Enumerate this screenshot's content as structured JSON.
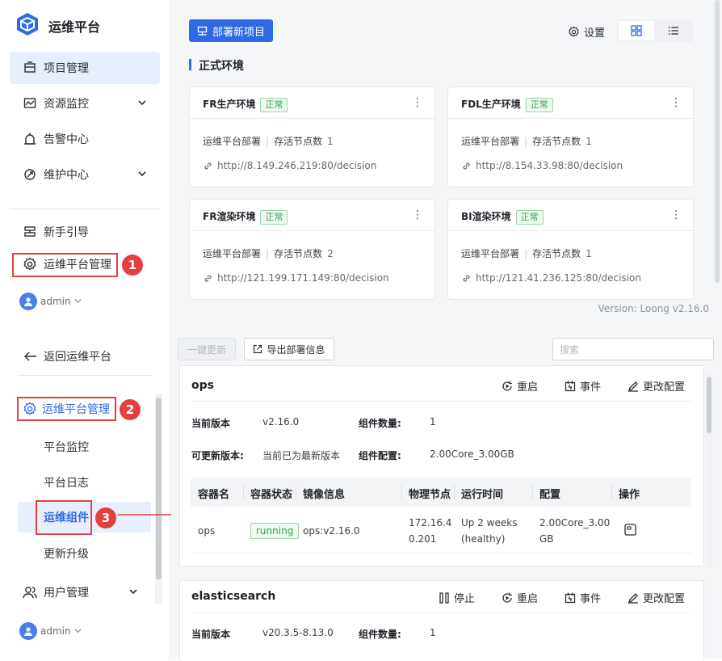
{
  "top": {
    "brand": "运维平台",
    "nav": [
      {
        "label": "项目管理",
        "icon": "project-icon",
        "active": true
      },
      {
        "label": "资源监控",
        "icon": "monitor-icon",
        "expandable": true
      },
      {
        "label": "告警中心",
        "icon": "alarm-icon"
      },
      {
        "label": "维护中心",
        "icon": "maintenance-icon",
        "expandable": true
      }
    ],
    "bottom_nav": [
      {
        "label": "新手引导",
        "icon": "guide-icon"
      },
      {
        "label": "运维平台管理",
        "icon": "gear-icon"
      }
    ],
    "user": "admin",
    "marker_1": "1",
    "deploy_button": "部署新项目",
    "settings_label": "设置",
    "section_title": "正式环境",
    "cards": [
      {
        "title": "FR生产环境",
        "status": "正常",
        "deploy": "运维平台部署",
        "nodes_label": "存活节点数",
        "nodes": "1",
        "url": "http://8.149.246.219:80/decision"
      },
      {
        "title": "FDL生产环境",
        "status": "正常",
        "deploy": "运维平台部署",
        "nodes_label": "存活节点数",
        "nodes": "1",
        "url": "http://8.154.33.98:80/decision"
      },
      {
        "title": "FR渲染环境",
        "status": "正常",
        "deploy": "运维平台部署",
        "nodes_label": "存活节点数",
        "nodes": "2",
        "url": "http://121.199.171.149:80/decision"
      },
      {
        "title": "BI渲染环境",
        "status": "正常",
        "deploy": "运维平台部署",
        "nodes_label": "存活节点数",
        "nodes": "1",
        "url": "http://121.41.236.125:80/decision"
      }
    ],
    "version": "Version: Loong v2.16.0"
  },
  "bottom": {
    "back_label": "返回运维平台",
    "mgmt_label": "运维平台管理",
    "marker_2": "2",
    "marker_3": "3",
    "subnav": [
      "平台监控",
      "平台日志",
      "运维组件",
      "更新升级"
    ],
    "user_mgmt": "用户管理",
    "user": "admin",
    "btn_update_all": "一键更新",
    "btn_export": "导出部署信息",
    "search_placeholder": "搜索",
    "panels": [
      {
        "name": "ops",
        "actions": [
          "重启",
          "事件",
          "更改配置"
        ],
        "current_version_label": "当前版本",
        "current_version": "v2.16.0",
        "component_count_label": "组件数量:",
        "component_count": "1",
        "updatable_label": "可更新版本:",
        "updatable": "当前已为最新版本",
        "config_label": "组件配置:",
        "config": "2.00Core_3.00GB",
        "table": {
          "headers": [
            "容器名",
            "容器状态",
            "镜像信息",
            "物理节点",
            "运行时间",
            "配置",
            "操作"
          ],
          "row": {
            "name": "ops",
            "status": "running",
            "image": "ops:v2.16.0",
            "node_l1": "172.16.4",
            "node_l2": "0.201",
            "uptime_l1": "Up 2 weeks",
            "uptime_l2": "(healthy)",
            "config_l1": "2.00Core_3.00",
            "config_l2": "GB"
          }
        }
      },
      {
        "name": "elasticsearch",
        "actions": [
          "停止",
          "重启",
          "事件",
          "更改配置"
        ],
        "current_version_label": "当前版本",
        "current_version": "v20.3.5-8.13.0",
        "component_count_label": "组件数量:",
        "component_count": "1"
      }
    ]
  },
  "colors": {
    "accent": "#2f6ae6",
    "annotation": "#e34040",
    "success": "#2ea44f"
  }
}
